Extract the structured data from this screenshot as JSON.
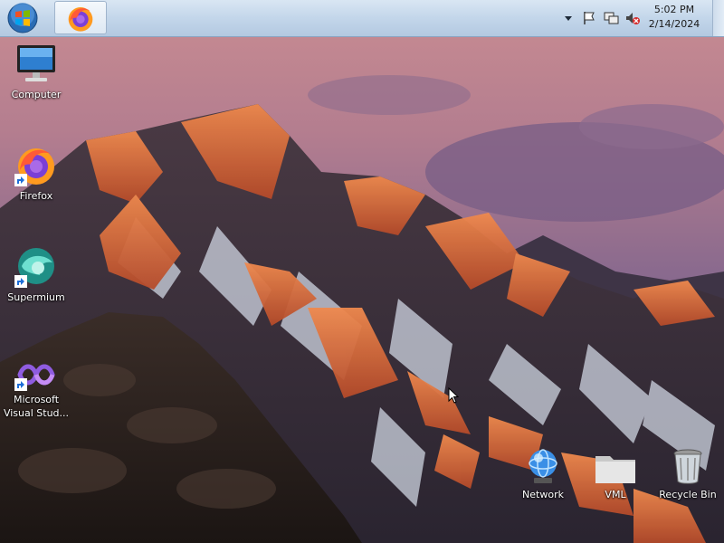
{
  "desktop": {
    "icons": [
      {
        "id": "computer",
        "label": "Computer",
        "icon": "computer-icon"
      },
      {
        "id": "firefox",
        "label": "Firefox",
        "icon": "firefox-icon",
        "shortcut": true
      },
      {
        "id": "supermium",
        "label": "Supermium",
        "icon": "supermium-icon",
        "shortcut": true
      },
      {
        "id": "visual-studio",
        "label_line1": "Microsoft",
        "label_line2": "Visual Stud...",
        "icon": "visual-studio-icon",
        "shortcut": true
      },
      {
        "id": "network",
        "label": "Network",
        "icon": "network-icon"
      },
      {
        "id": "vml",
        "label": "VML",
        "icon": "folder-icon"
      },
      {
        "id": "recycle-bin",
        "label": "Recycle Bin",
        "icon": "recycle-bin-icon"
      }
    ]
  },
  "taskbar": {
    "start_icon": "windows-orb-icon",
    "pinned_apps": [
      {
        "name": "Firefox",
        "icon": "firefox-icon",
        "active": true
      }
    ],
    "tray_icons": [
      "show-hidden-icons-arrow",
      "action-center-flag-icon",
      "network-icon",
      "volume-muted-icon"
    ],
    "clock": {
      "time": "5:02 PM",
      "date": "2/14/2024"
    }
  },
  "colors": {
    "taskbar_top": "#d9e6f3",
    "taskbar_bottom": "#b3c9e1",
    "sky_top": "#c98a94",
    "sky_bottom": "#6d5a86",
    "peak_glow": "#e8703c"
  }
}
